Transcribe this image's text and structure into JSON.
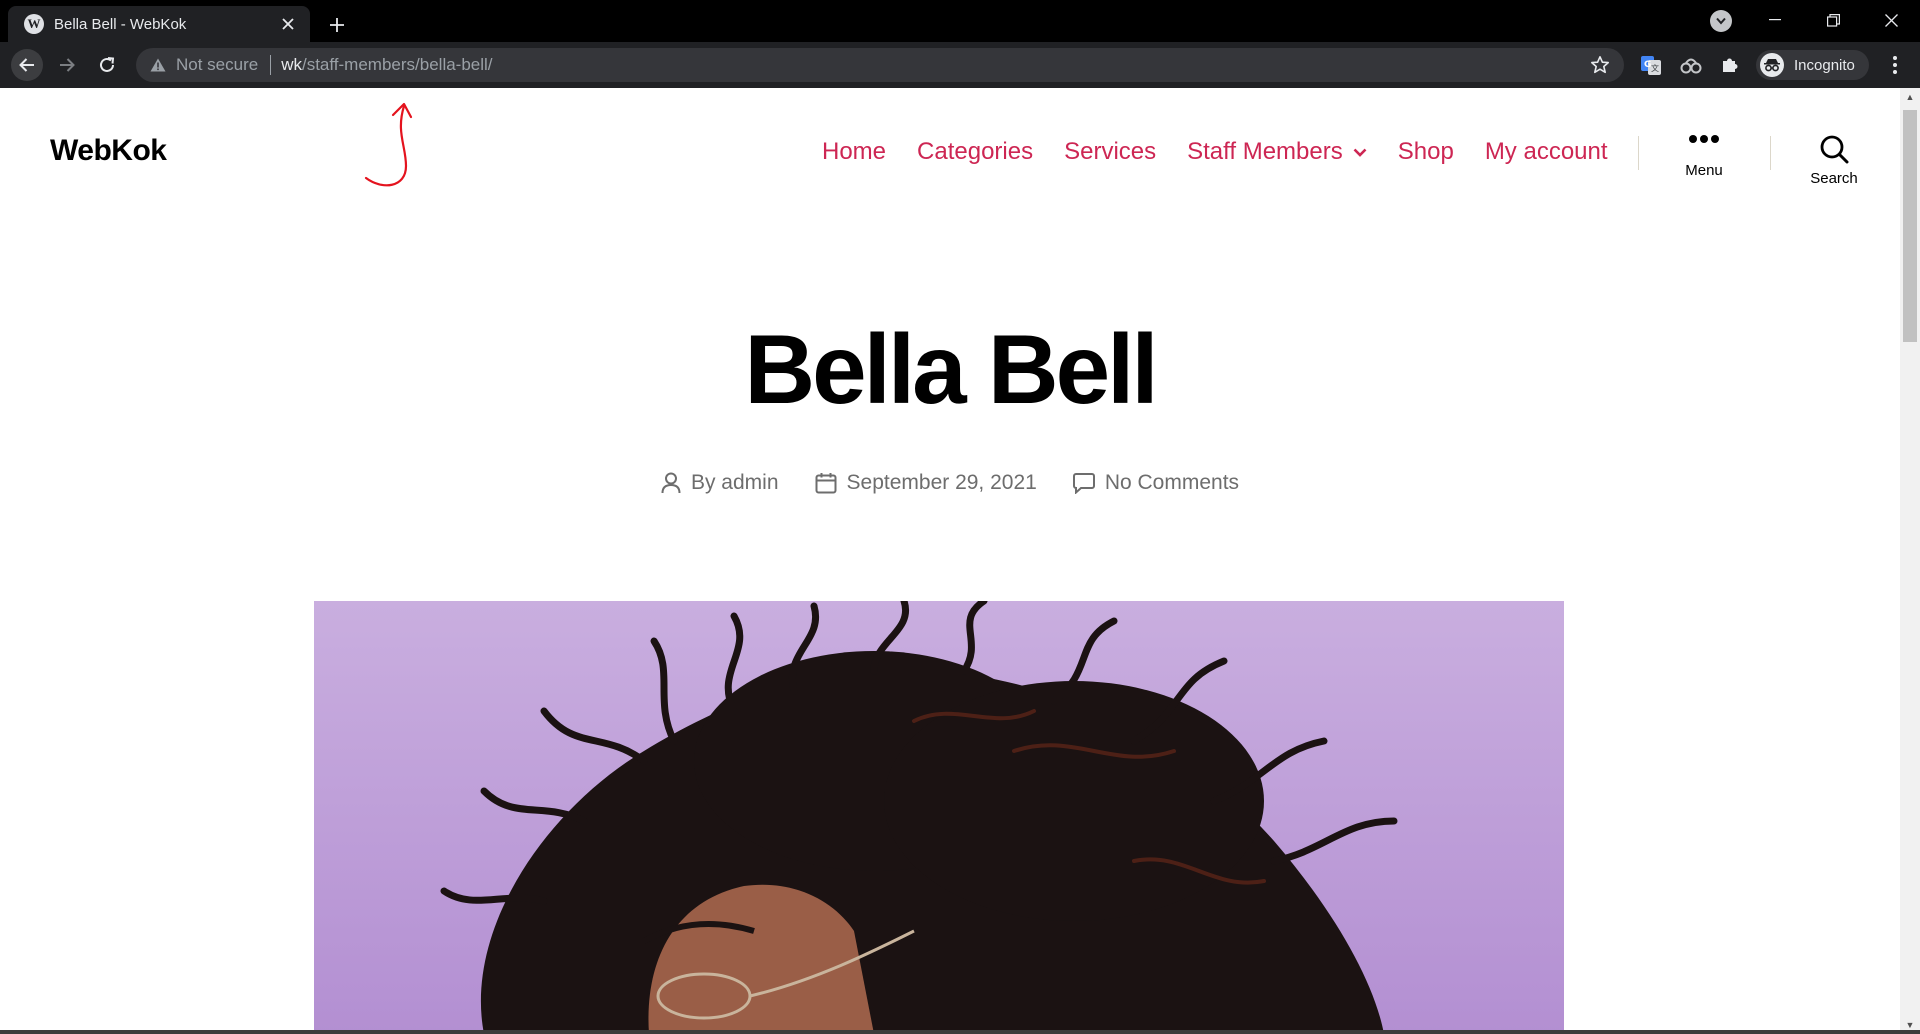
{
  "browser": {
    "tab": {
      "title": "Bella Bell - WebKok",
      "favicon": "wordpress-icon"
    },
    "omnibox": {
      "security_label": "Not secure",
      "url_host": "wk",
      "url_path": "/staff-members/bella-bell/"
    },
    "profile_label": "Incognito"
  },
  "site": {
    "title": "WebKok",
    "accent_color": "#cd2653",
    "nav": [
      {
        "label": "Home"
      },
      {
        "label": "Categories"
      },
      {
        "label": "Services"
      },
      {
        "label": "Staff Members",
        "has_submenu": true
      },
      {
        "label": "Shop"
      },
      {
        "label": "My account"
      }
    ],
    "menu_toggle_label": "Menu",
    "search_toggle_label": "Search"
  },
  "post": {
    "title": "Bella Bell",
    "author": "By admin",
    "date": "September 29, 2021",
    "comments": "No Comments"
  }
}
